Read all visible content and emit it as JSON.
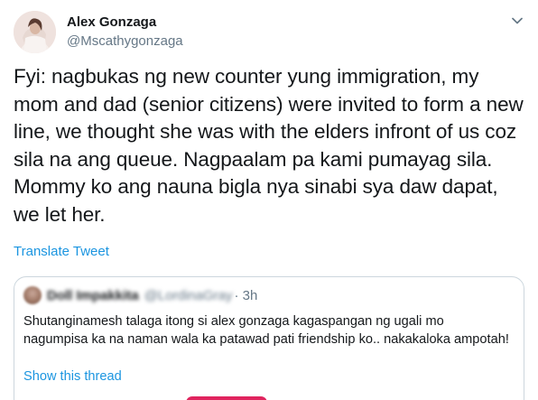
{
  "author": {
    "name": "Alex Gonzaga",
    "handle": "@Mscathygonzaga",
    "avatar_icon": "profile-photo"
  },
  "menu": {
    "icon": "chevron-down-icon",
    "color": "#657786"
  },
  "tweet": {
    "text": "Fyi: nagbukas ng new counter yung immigration, my mom and dad (senior citizens) were invited to form a new line, we thought she was with the elders infront of us coz sila na ang queue. Nagpaalam pa kami pumayag sila. Mommy ko ang nauna bigla nya sinabi sya daw dapat, we let her.",
    "translate_label": "Translate Tweet"
  },
  "quoted": {
    "name": "Doll Impakkita",
    "handle": "@LordinaGray",
    "time": "· 3h",
    "text": "Shutanginamesh talaga itong  si alex gonzaga kagaspangan ng ugali mo nagumpisa ka na naman wala ka patawad pati friendship ko.. nakakaloka ampotah!",
    "show_thread_label": "Show this thread",
    "media_accent_color": "#e0245e"
  },
  "colors": {
    "link": "#1b95e0",
    "secondary_text": "#657786",
    "border": "#ccd6dd"
  }
}
